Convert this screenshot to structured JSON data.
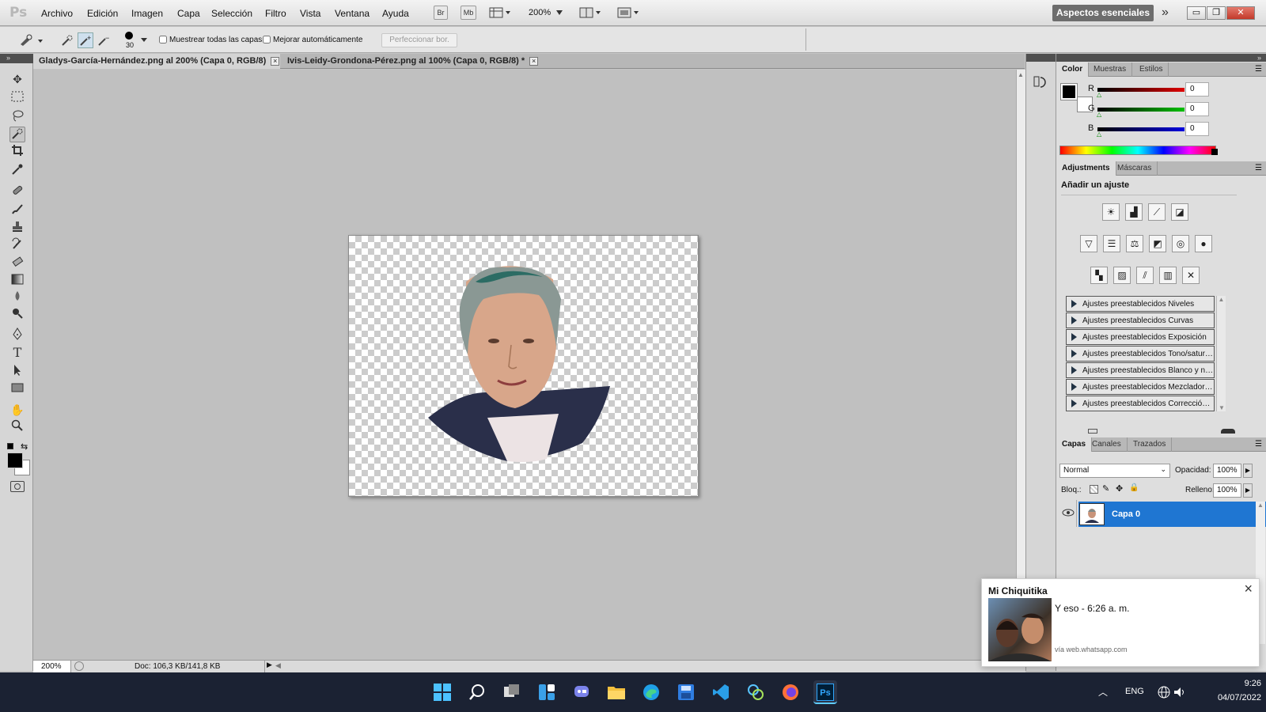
{
  "app": {
    "logo": "Ps"
  },
  "menu": [
    "Archivo",
    "Edición",
    "Imagen",
    "Capa",
    "Selección",
    "Filtro",
    "Vista",
    "Ventana",
    "Ayuda"
  ],
  "toolbar": {
    "br": "Br",
    "mb": "Mb",
    "zoom": "200%",
    "workspace": "Aspectos esenciales",
    "min": "▭",
    "restore": "❐",
    "close": "✕"
  },
  "options": {
    "brush_size": "30",
    "sample_all": "Muestrear todas las capas",
    "auto_enhance": "Mejorar automáticamente",
    "refine": "Perfeccionar bor."
  },
  "tabs": [
    {
      "label": "Gladys-García-Hernández.png al 200% (Capa 0, RGB/8)",
      "active": true
    },
    {
      "label": "Ivis-Leidy-Grondona-Pérez.png al 100% (Capa 0, RGB/8) *",
      "active": false
    }
  ],
  "status": {
    "zoom": "200%",
    "doc": "Doc: 106,3 KB/141,8 KB"
  },
  "color_panel": {
    "tabs": [
      "Color",
      "Muestras",
      "Estilos"
    ],
    "channels": [
      {
        "label": "R",
        "value": "0",
        "color": "#e00000"
      },
      {
        "label": "G",
        "value": "0",
        "color": "#00c000"
      },
      {
        "label": "B",
        "value": "0",
        "color": "#0000e0"
      }
    ]
  },
  "adjustments": {
    "tabs": [
      "Adjustments",
      "Máscaras"
    ],
    "title": "Añadir un ajuste",
    "presets": [
      "Ajustes preestablecidos Niveles",
      "Ajustes preestablecidos Curvas",
      "Ajustes preestablecidos Exposición",
      "Ajustes preestablecidos Tono/saturación",
      "Ajustes preestablecidos Blanco y negro",
      "Ajustes preestablecidos Mezclador de canales",
      "Ajustes preestablecidos Corrección selectiva"
    ]
  },
  "layers": {
    "tabs": [
      "Capas",
      "Canales",
      "Trazados"
    ],
    "blend": "Normal",
    "opacity_label": "Opacidad:",
    "opacity": "100%",
    "lock_label": "Bloq.:",
    "fill_label": "Relleno:",
    "fill": "100%",
    "layer_name": "Capa 0"
  },
  "notification": {
    "title": "Mi Chiquitika",
    "message": "Y eso - 6:26 a. m.",
    "source": "vía web.whatsapp.com"
  },
  "taskbar": {
    "lang": "ENG",
    "time": "9:26",
    "date": "04/07/2022"
  }
}
